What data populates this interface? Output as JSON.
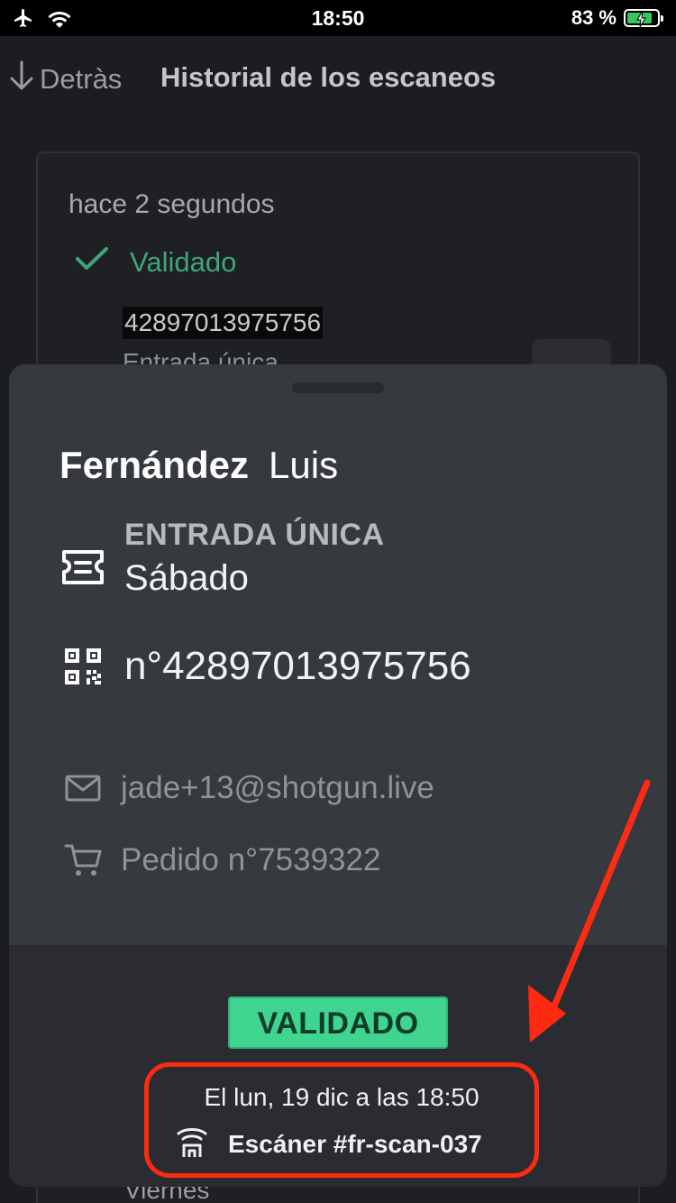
{
  "status_bar": {
    "time": "18:50",
    "battery_percent": "83 %",
    "battery_level": 83,
    "icons": [
      "airplane-icon",
      "wifi-icon",
      "battery-charging-icon"
    ]
  },
  "nav": {
    "back_label": "Detràs",
    "title": "Historial de los escaneos"
  },
  "scan_item": {
    "time_ago": "hace 2 segundos",
    "status": "Validado",
    "ticket_number": "42897013975756",
    "ticket_type": "Entrada única",
    "day_label": "Viernes"
  },
  "sheet": {
    "last_name": "Fernández",
    "first_name": "Luis",
    "ticket_type": "ENTRADA ÚNICA",
    "ticket_day": "Sábado",
    "ticket_number": "n°42897013975756",
    "email": "jade+13@shotgun.live",
    "order": "Pedido n°7539322",
    "status_badge": "VALIDADO",
    "scan_date": "El lun, 19 dic a las 18:50",
    "scanner": "Escáner #fr-scan-037"
  },
  "colors": {
    "background": "#1c1d20",
    "sheet": "#36393e",
    "accent_green": "#3fd490",
    "status_green": "#3fa57b",
    "annotation_red": "#ff2a12"
  }
}
